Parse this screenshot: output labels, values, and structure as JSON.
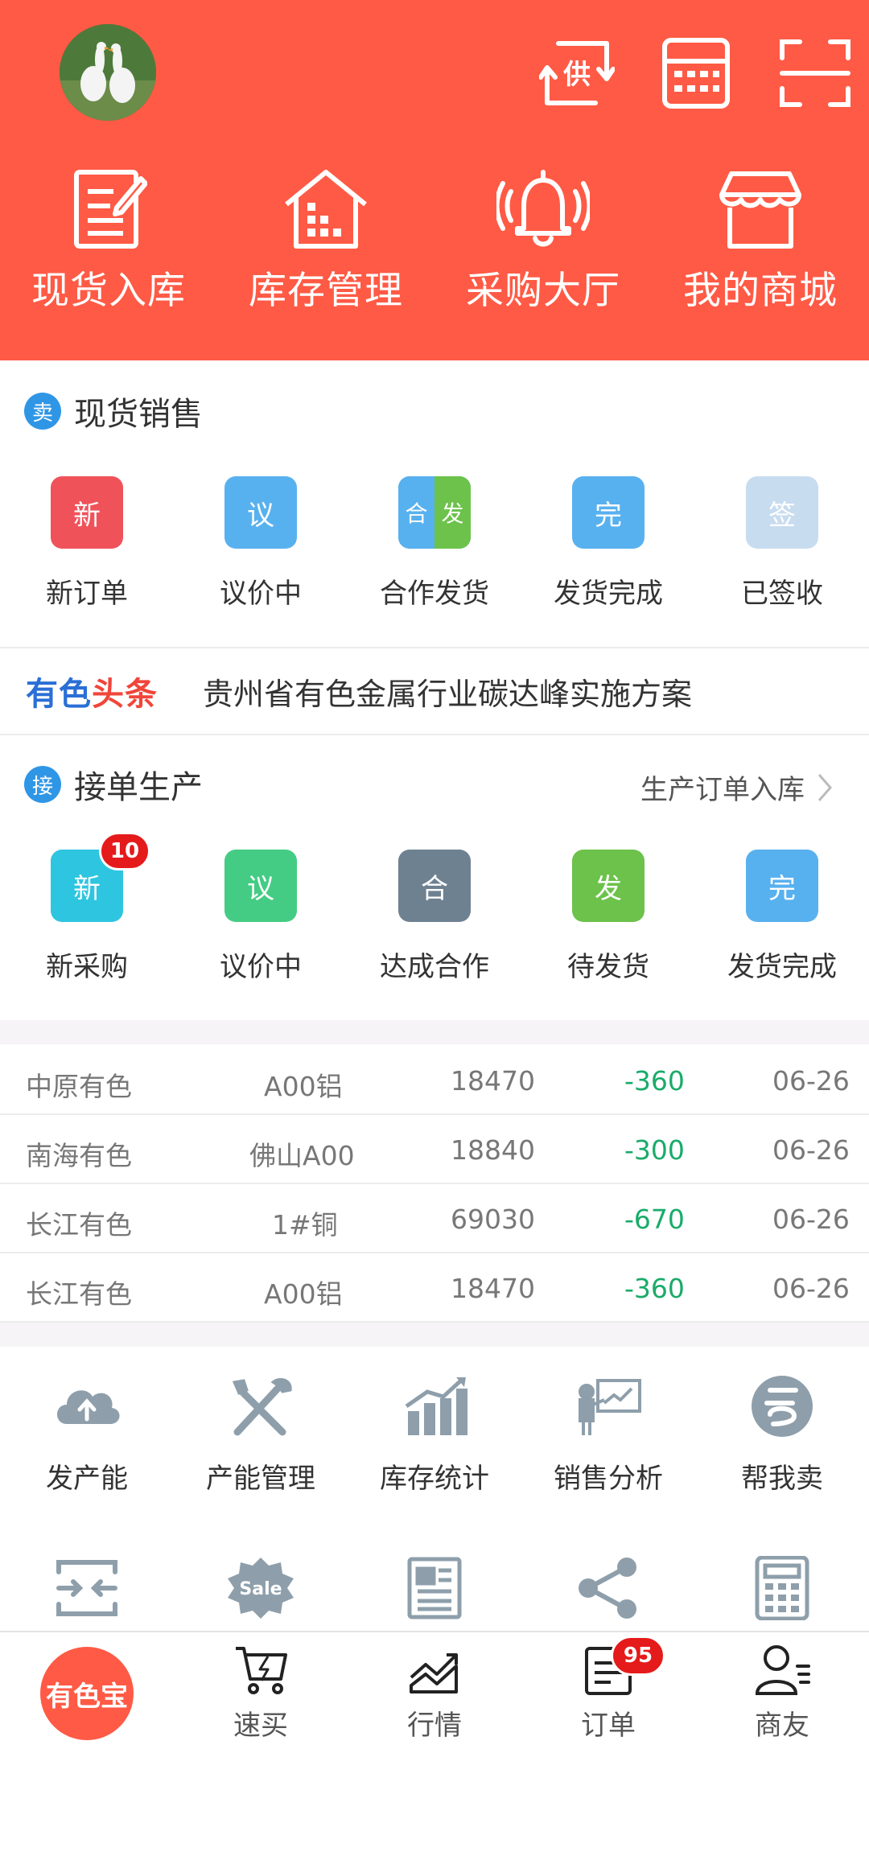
{
  "header": {
    "menu": [
      {
        "label": "现货入库",
        "icon": "edit-document-icon"
      },
      {
        "label": "库存管理",
        "icon": "warehouse-icon"
      },
      {
        "label": "采购大厅",
        "icon": "bell-icon"
      },
      {
        "label": "我的商城",
        "icon": "shop-icon"
      }
    ],
    "supply_glyph": "供",
    "accent": "#ff5a45"
  },
  "spot_sales": {
    "badge": "卖",
    "title": "现货销售",
    "items": [
      {
        "tile": "新",
        "label": "新订单",
        "color": "#f0525a"
      },
      {
        "tile": "议",
        "label": "议价中",
        "color": "#58b1ef"
      },
      {
        "tile_left": "合",
        "tile_right": "发",
        "label": "合作发货",
        "color_left": "#58b1ef",
        "color_right": "#6cc24a"
      },
      {
        "tile": "完",
        "label": "发货完成",
        "color": "#58b1ef"
      },
      {
        "tile": "签",
        "label": "已签收",
        "color": "#c8dcef"
      }
    ]
  },
  "news": {
    "brand_part1": "有色",
    "brand_part2": "头条",
    "headline": "贵州省有色金属行业碳达峰实施方案"
  },
  "production": {
    "badge": "接",
    "title": "接单生产",
    "link": "生产订单入库",
    "items": [
      {
        "tile": "新",
        "label": "新采购",
        "color": "#2ec5e0",
        "count": "10"
      },
      {
        "tile": "议",
        "label": "议价中",
        "color": "#44cc84"
      },
      {
        "tile": "合",
        "label": "达成合作",
        "color": "#6e8191"
      },
      {
        "tile": "发",
        "label": "待发货",
        "color": "#6cc24a"
      },
      {
        "tile": "完",
        "label": "发货完成",
        "color": "#58b1ef"
      }
    ]
  },
  "prices": [
    {
      "market": "中原有色",
      "product": "A00铝",
      "price": "18470",
      "change": "-360",
      "date": "06-26"
    },
    {
      "market": "南海有色",
      "product": "佛山A00",
      "price": "18840",
      "change": "-300",
      "date": "06-26"
    },
    {
      "market": "长江有色",
      "product": "1#铜",
      "price": "69030",
      "change": "-670",
      "date": "06-26"
    },
    {
      "market": "长江有色",
      "product": "A00铝",
      "price": "18470",
      "change": "-360",
      "date": "06-26"
    }
  ],
  "tools": [
    {
      "label": "发产能",
      "icon": "cloud-upload-icon"
    },
    {
      "label": "产能管理",
      "icon": "tools-icon"
    },
    {
      "label": "库存统计",
      "icon": "bar-chart-icon"
    },
    {
      "label": "销售分析",
      "icon": "presentation-icon"
    },
    {
      "label": "帮我卖",
      "icon": "sell-icon"
    }
  ],
  "tools_row2": [
    {
      "icon": "merge-arrows-icon"
    },
    {
      "icon": "sale-badge-icon",
      "text": "Sale"
    },
    {
      "icon": "newspaper-icon"
    },
    {
      "icon": "share-icon"
    },
    {
      "icon": "calculator-icon"
    }
  ],
  "tabbar": {
    "home": "有色宝",
    "tabs": [
      {
        "label": "速买",
        "icon": "cart-icon"
      },
      {
        "label": "行情",
        "icon": "trend-icon"
      },
      {
        "label": "订单",
        "icon": "order-icon",
        "count": "95"
      },
      {
        "label": "商友",
        "icon": "contacts-icon"
      }
    ]
  }
}
